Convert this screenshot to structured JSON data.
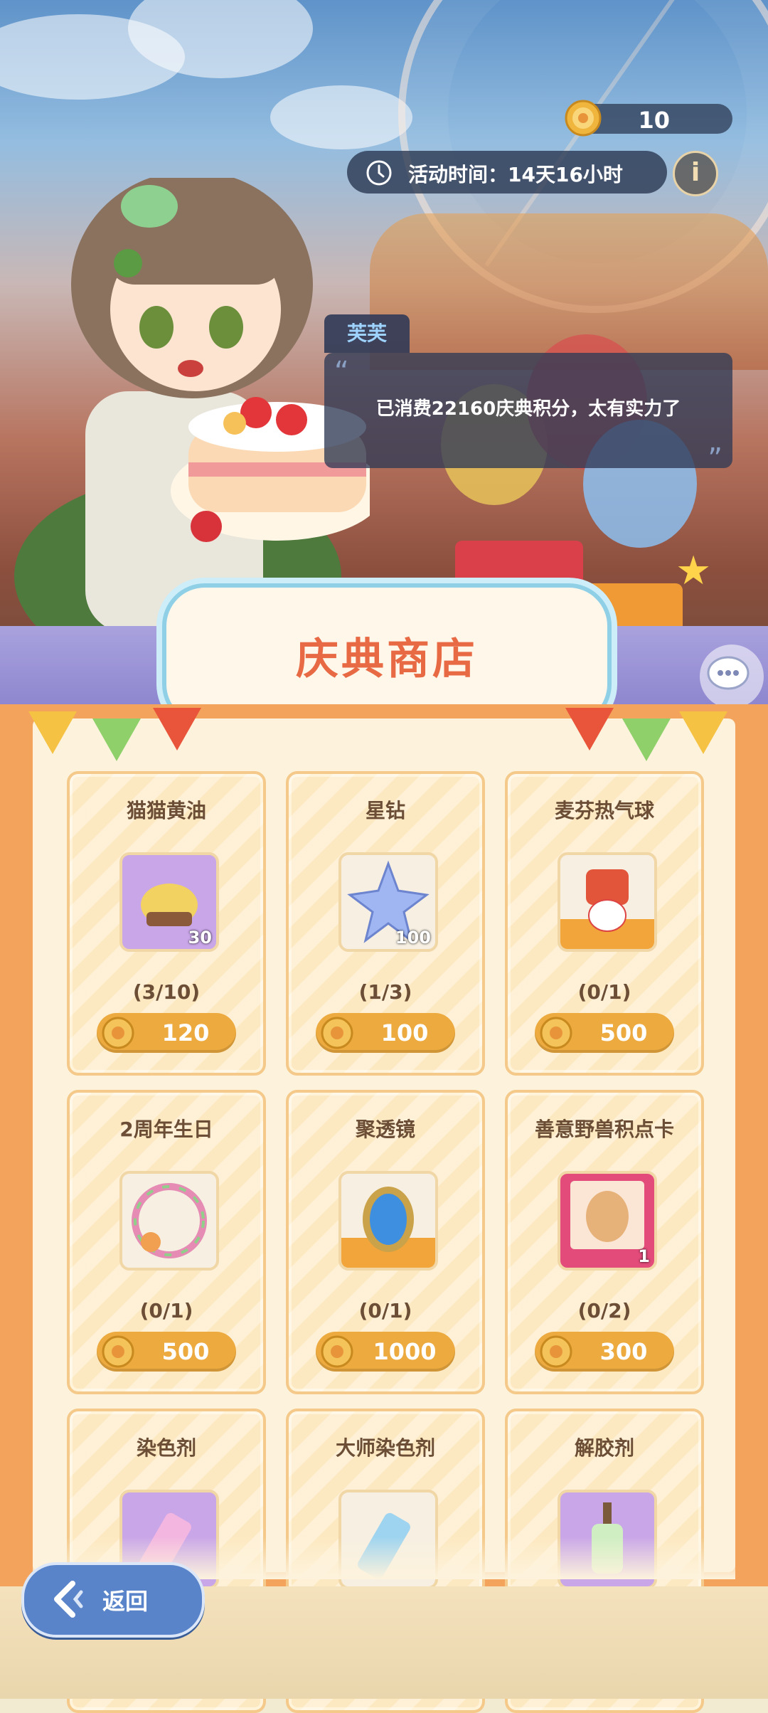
{
  "hud": {
    "currency_icon": "festival-coin-icon",
    "currency_value": "10",
    "event_time_label": "活动时间：14天16小时",
    "info_label": "i"
  },
  "npc": {
    "name": "芙芙",
    "dialogue": "已消费22160庆典积分，太有实力了"
  },
  "shop": {
    "title": "庆典商店",
    "items": [
      {
        "name": "猫猫黄油",
        "qty": "30",
        "limit": "(3/10)",
        "price": "120",
        "icon": "cat-butter-icon"
      },
      {
        "name": "星钻",
        "qty": "100",
        "limit": "(1/3)",
        "price": "100",
        "icon": "star-diamond-icon"
      },
      {
        "name": "麦芬热气球",
        "qty": "",
        "limit": "(0/1)",
        "price": "500",
        "icon": "muffin-balloon-icon"
      },
      {
        "name": "2周年生日",
        "qty": "",
        "limit": "(0/1)",
        "price": "500",
        "icon": "anniversary-frame-icon"
      },
      {
        "name": "聚透镜",
        "qty": "",
        "limit": "(0/1)",
        "price": "1000",
        "icon": "mirror-icon"
      },
      {
        "name": "善意野兽积点卡",
        "qty": "1",
        "limit": "(0/2)",
        "price": "300",
        "icon": "beast-card-icon"
      },
      {
        "name": "染色剂",
        "qty": "",
        "limit": "",
        "price": "",
        "icon": "dye-tube-icon"
      },
      {
        "name": "大师染色剂",
        "qty": "",
        "limit": "",
        "price": "",
        "icon": "master-dye-icon"
      },
      {
        "name": "解胶剂",
        "qty": "",
        "limit": "",
        "price": "",
        "icon": "solvent-bottle-icon"
      }
    ]
  },
  "footer": {
    "back_label": "返回"
  },
  "colors": {
    "accent": "#e86a44",
    "button": "#ecaa3f",
    "panel": "#f3a35b",
    "back_button": "#5a84c9"
  }
}
